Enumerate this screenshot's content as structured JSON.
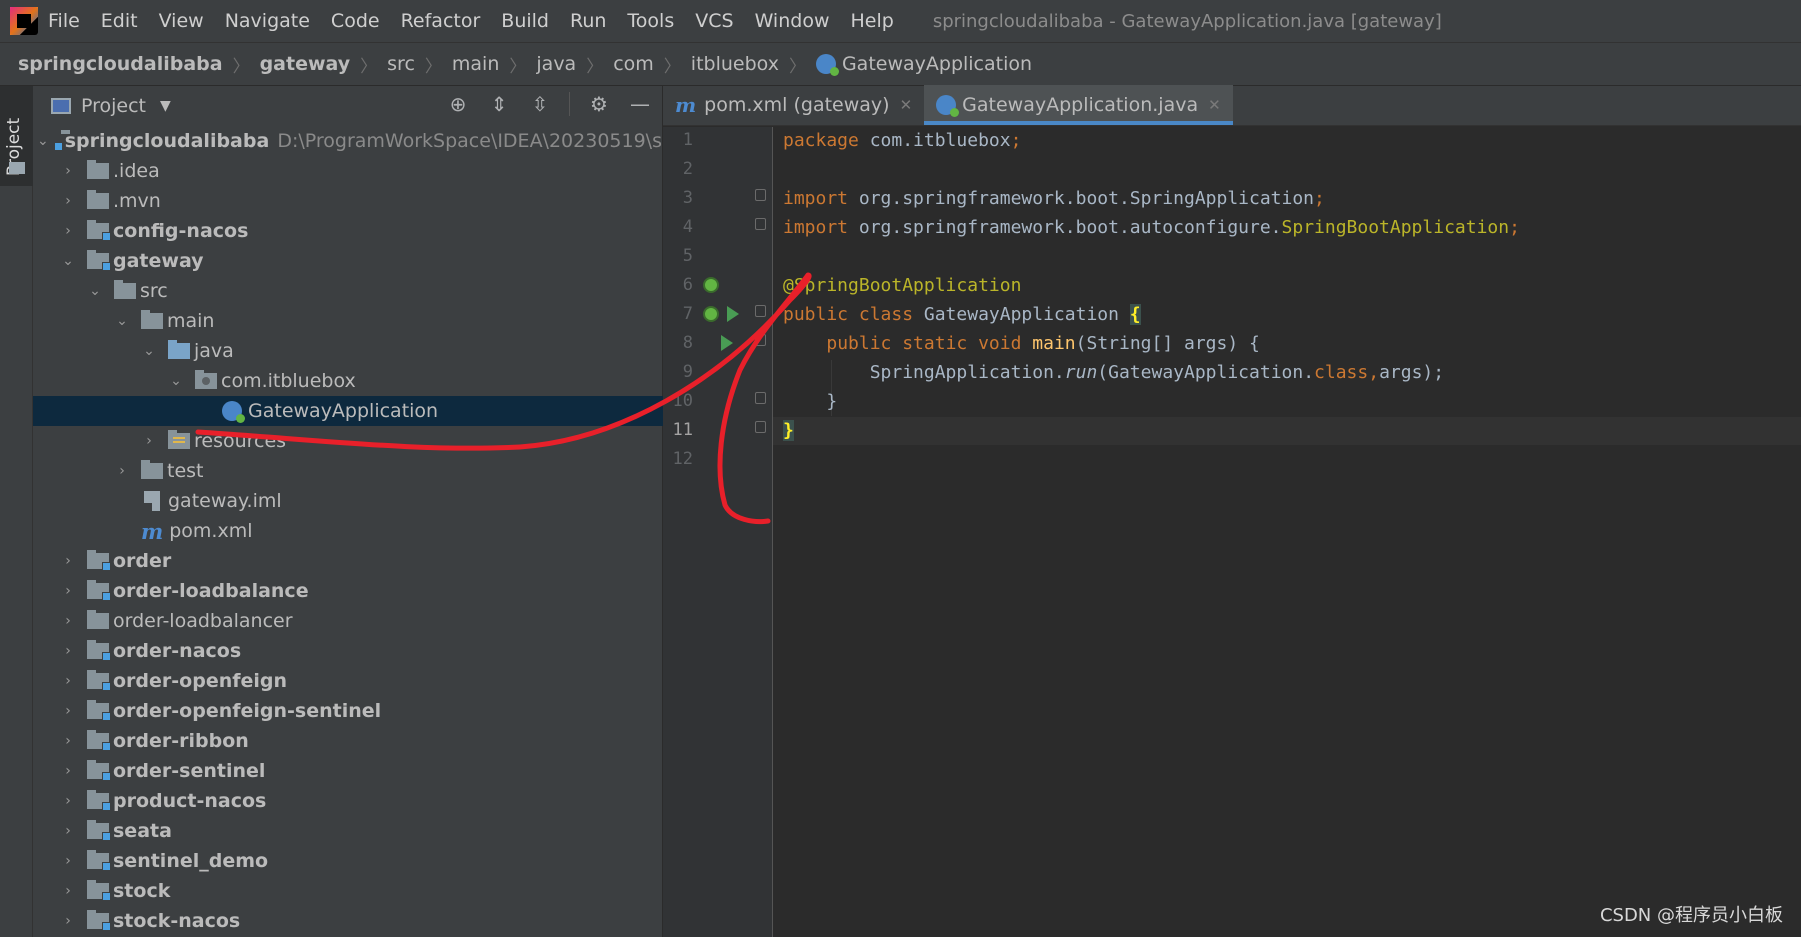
{
  "menubar": {
    "items": [
      "File",
      "Edit",
      "View",
      "Navigate",
      "Code",
      "Refactor",
      "Build",
      "Run",
      "Tools",
      "VCS",
      "Window",
      "Help"
    ],
    "window_title": "springcloudalibaba - GatewayApplication.java [gateway]"
  },
  "breadcrumb": {
    "items": [
      "springcloudalibaba",
      "gateway",
      "src",
      "main",
      "java",
      "com",
      "itbluebox",
      "GatewayApplication"
    ]
  },
  "toolstrip": {
    "project_tab": "Project"
  },
  "project_panel": {
    "title": "Project",
    "root": {
      "name": "springcloudalibaba",
      "path": "D:\\ProgramWorkSpace\\IDEA\\20230519\\sprin"
    },
    "tree": [
      {
        "label": ".idea",
        "bold": false
      },
      {
        "label": ".mvn",
        "bold": false
      },
      {
        "label": "config-nacos",
        "bold": true
      },
      {
        "label": "gateway",
        "bold": true
      },
      {
        "label": "src",
        "bold": false
      },
      {
        "label": "main",
        "bold": false
      },
      {
        "label": "java",
        "bold": false
      },
      {
        "label": "com.itbluebox",
        "bold": false
      },
      {
        "label": "GatewayApplication",
        "bold": false
      },
      {
        "label": "resources",
        "bold": false
      },
      {
        "label": "test",
        "bold": false
      },
      {
        "label": "gateway.iml",
        "bold": false
      },
      {
        "label": "pom.xml",
        "bold": false
      },
      {
        "label": "order",
        "bold": true
      },
      {
        "label": "order-loadbalance",
        "bold": true
      },
      {
        "label": "order-loadbalancer",
        "bold": false
      },
      {
        "label": "order-nacos",
        "bold": true
      },
      {
        "label": "order-openfeign",
        "bold": true
      },
      {
        "label": "order-openfeign-sentinel",
        "bold": true
      },
      {
        "label": "order-ribbon",
        "bold": true
      },
      {
        "label": "order-sentinel",
        "bold": true
      },
      {
        "label": "product-nacos",
        "bold": true
      },
      {
        "label": "seata",
        "bold": true
      },
      {
        "label": "sentinel_demo",
        "bold": true
      },
      {
        "label": "stock",
        "bold": true
      },
      {
        "label": "stock-nacos",
        "bold": true
      }
    ]
  },
  "editor": {
    "tabs": [
      {
        "label": "pom.xml (gateway)",
        "active": false
      },
      {
        "label": "GatewayApplication.java",
        "active": true
      }
    ],
    "line_numbers": [
      "1",
      "2",
      "3",
      "4",
      "5",
      "6",
      "7",
      "8",
      "9",
      "10",
      "11",
      "12"
    ],
    "current_line": 11,
    "code": {
      "l1_kw": "package",
      "l1_rest": " com.itbluebox",
      "l1_semi": ";",
      "l3_kw": "import",
      "l3_rest": " org.springframework.boot.SpringApplication",
      "l3_semi": ";",
      "l4_kw": "import",
      "l4_rest": " org.springframework.boot.autoconfigure.",
      "l4_ann": "SpringBootApplication",
      "l4_semi": ";",
      "l6_ann": "@SpringBootApplication",
      "l7_kw": "public class",
      "l7_name": " GatewayApplication ",
      "l7_brace": "{",
      "l8_indent": "    ",
      "l8_kw": "public static void",
      "l8_sp": " ",
      "l8_fn": "main",
      "l8_rest": "(String[] args) {",
      "l9_indent": "        ",
      "l9_obj": "SpringApplication.",
      "l9_run": "run",
      "l9_args": "(GatewayApplication.",
      "l9_kw": "class",
      "l9_comma": ",",
      "l9_end": "args);",
      "l10": "    }",
      "l11_brace": "}"
    }
  },
  "annotation_color": "#e8202a",
  "watermark": "CSDN @程序员小白板"
}
